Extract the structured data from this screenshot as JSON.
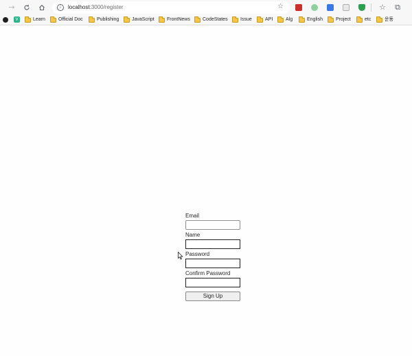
{
  "browser": {
    "address_bar": {
      "host": "localhost",
      "path": ":3000/register"
    },
    "toolbar": {
      "back_icon": "arrow-left-icon",
      "forward_icon": "arrow-right-icon",
      "reload_icon": "reload-icon",
      "home_icon": "home-icon"
    },
    "bookmarks": [
      {
        "label": "Learn"
      },
      {
        "label": "Official Doc"
      },
      {
        "label": "Publishing"
      },
      {
        "label": "JavaScript"
      },
      {
        "label": "FrontNews"
      },
      {
        "label": "CodeStates"
      },
      {
        "label": "Issue"
      },
      {
        "label": "API"
      },
      {
        "label": "Alg"
      },
      {
        "label": "English"
      },
      {
        "label": "Project"
      },
      {
        "label": "etc"
      },
      {
        "label": "운동"
      }
    ]
  },
  "form": {
    "email_label": "Email",
    "email_value": "",
    "name_label": "Name",
    "name_value": "",
    "password_label": "Password",
    "password_value": "",
    "confirm_password_label": "Confirm Password",
    "confirm_password_value": "",
    "submit_label": "Sign Up"
  },
  "colors": {
    "folder": "#f5c54a",
    "vuetify_green": "#2fb48a",
    "page_background": "#fefefe"
  }
}
